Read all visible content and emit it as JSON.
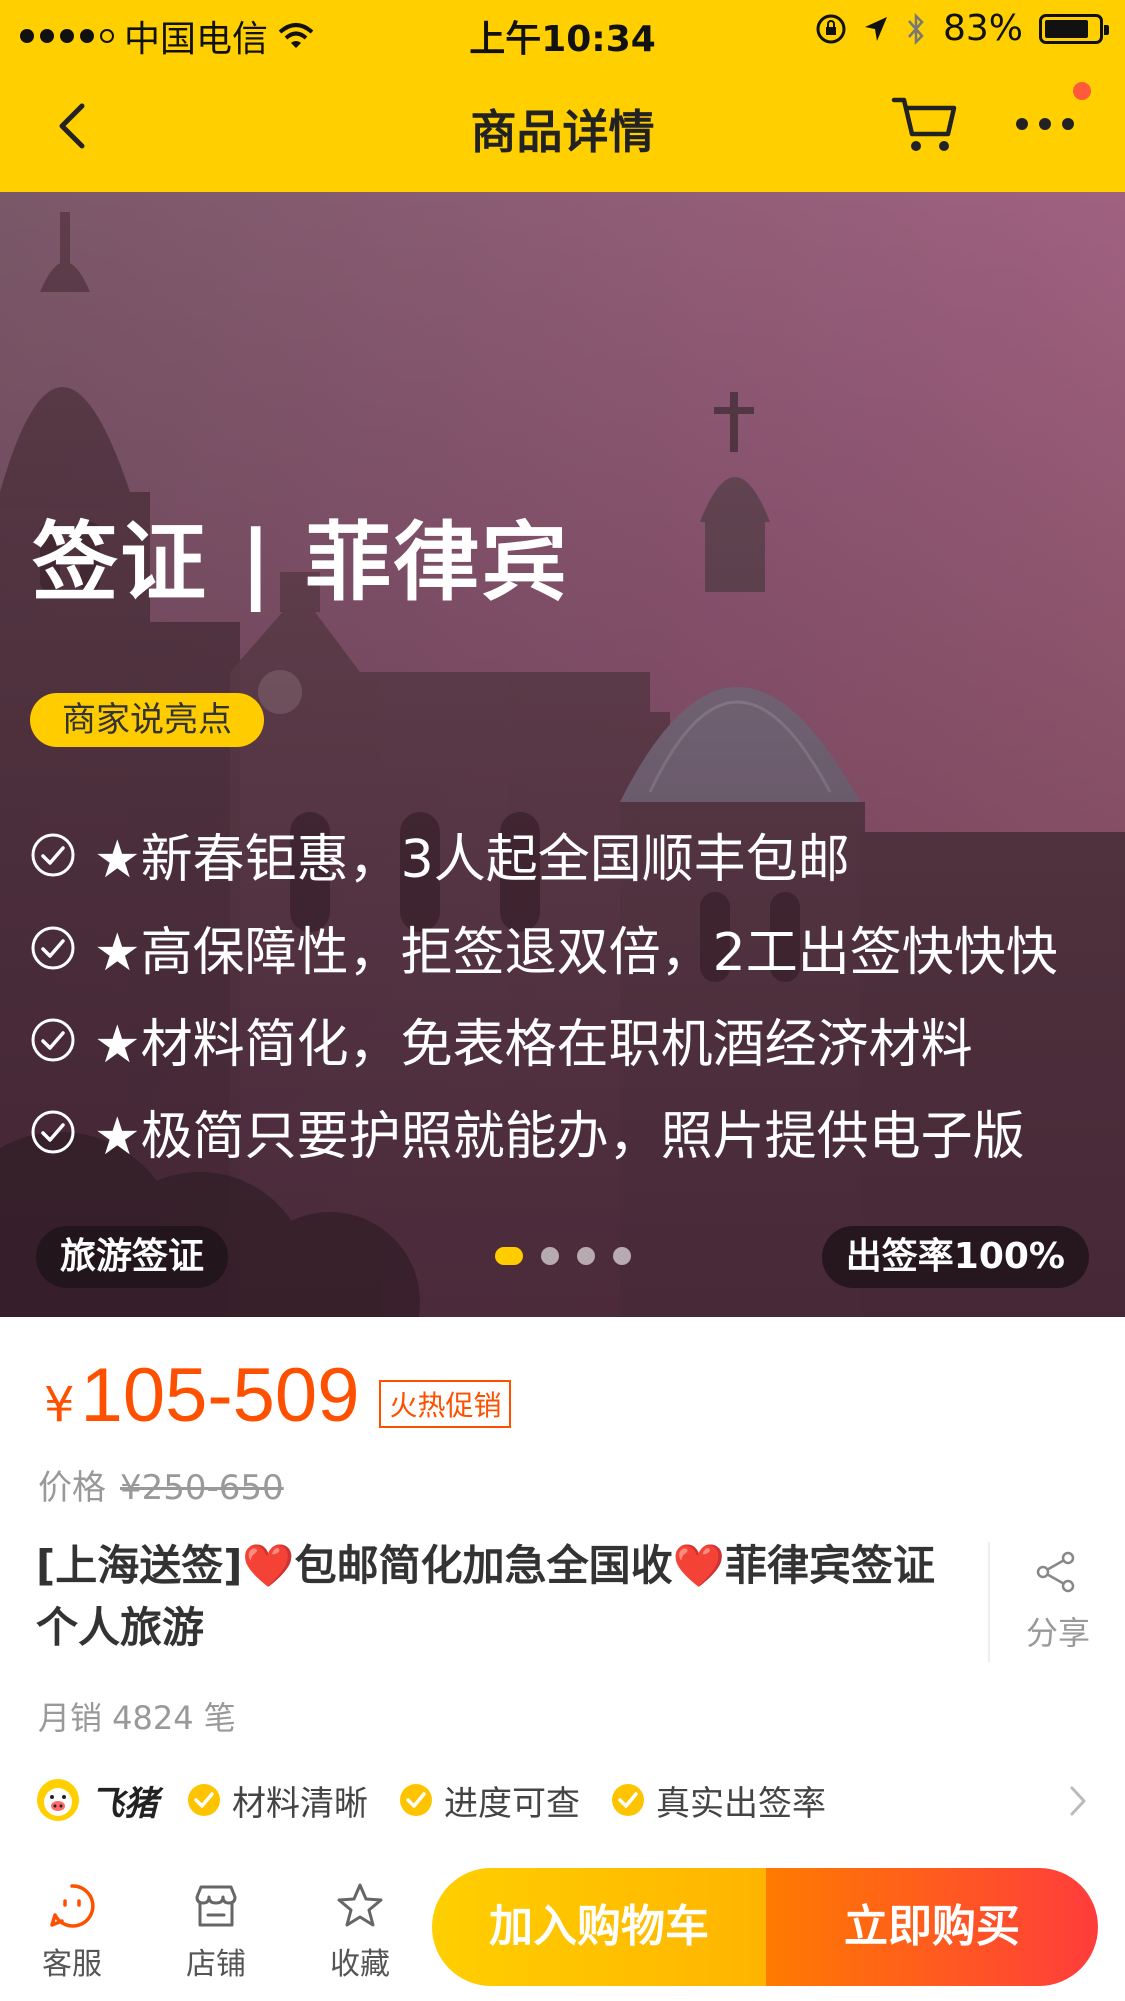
{
  "status_bar": {
    "carrier": "中国电信",
    "time": "上午10:34",
    "battery_percent": 83,
    "battery_text": "83%"
  },
  "nav": {
    "title": "商品详情",
    "icons": [
      "back-icon",
      "cart-icon",
      "more-icon"
    ],
    "has_notification_dot": true
  },
  "hero": {
    "title": "签证 | 菲律宾",
    "highlight_badge": "商家说亮点",
    "features": [
      "★新春钜惠，3人起全国顺丰包邮",
      "★高保障性，拒签退双倍，2工出签快快快",
      "★材料简化，免表格在职机酒经济材料",
      "★极简只要护照就能办，照片提供电子版"
    ],
    "tag_left": "旅游签证",
    "tag_right": "出签率100%",
    "page_count": 4,
    "active_page": 1,
    "accent_color": "#ffcc00"
  },
  "product": {
    "currency": "¥",
    "price_range": "105-509",
    "promo_tag": "火热促销",
    "original_label": "价格",
    "original_price": "¥250-650",
    "title": "[上海送签]❤️包邮简化加急全国收❤️菲律宾签证个人旅游",
    "share_label": "分享",
    "monthly_sales": "月销 4824 笔",
    "price_color": "#ff5000"
  },
  "guarantees": {
    "brand": "飞猪",
    "items": [
      "材料清晰",
      "进度可查",
      "真实出签率"
    ]
  },
  "bottom_bar": {
    "tabs": [
      {
        "label": "客服",
        "icon": "customer-service-icon"
      },
      {
        "label": "店铺",
        "icon": "store-icon"
      },
      {
        "label": "收藏",
        "icon": "star-icon"
      }
    ],
    "add_to_cart": "加入购物车",
    "buy_now": "立即购买"
  }
}
